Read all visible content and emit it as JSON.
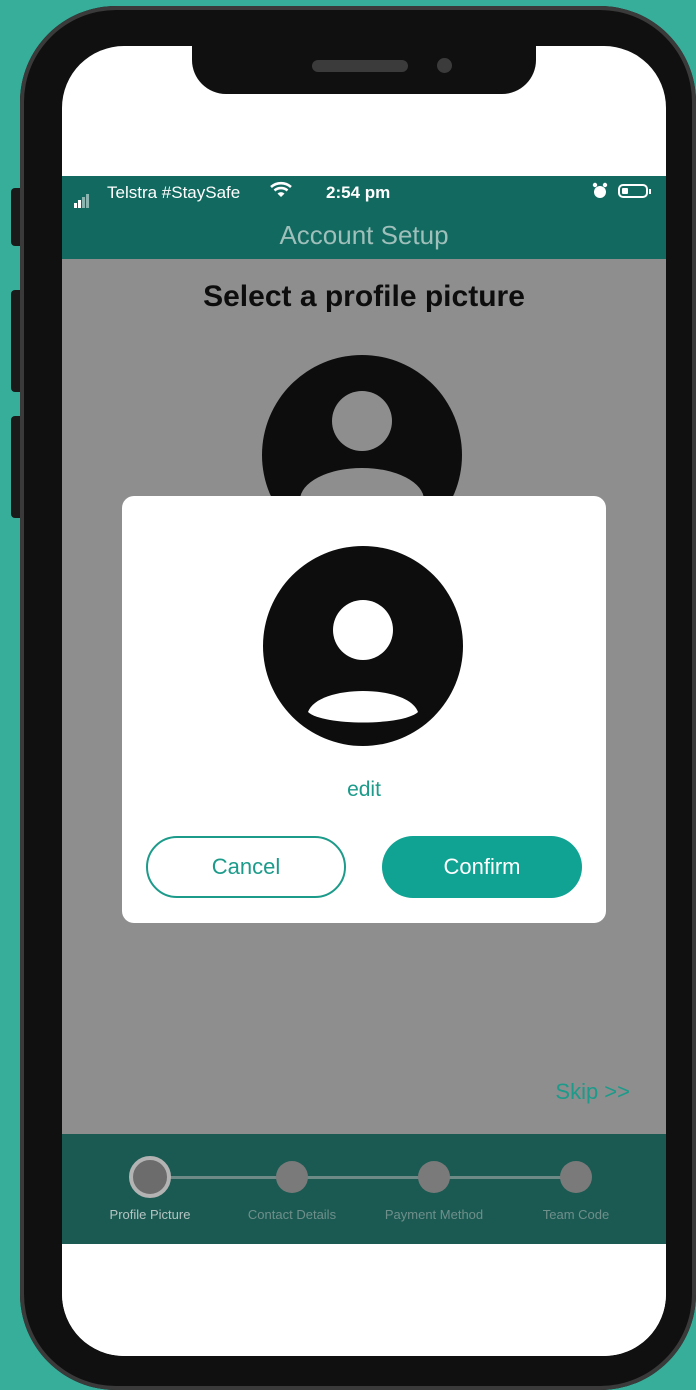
{
  "status_bar": {
    "carrier": "Telstra #StaySafe",
    "time": "2:54 pm"
  },
  "header": {
    "title": "Account Setup"
  },
  "page": {
    "title": "Select a profile picture",
    "skip_label": "Skip >>"
  },
  "modal": {
    "edit_label": "edit",
    "cancel_label": "Cancel",
    "confirm_label": "Confirm"
  },
  "stepper": {
    "steps": [
      {
        "label": "Profile Picture",
        "active": true
      },
      {
        "label": "Contact Details",
        "active": false
      },
      {
        "label": "Payment Method",
        "active": false
      },
      {
        "label": "Team Code",
        "active": false
      }
    ]
  },
  "colors": {
    "background": "#37ae9a",
    "header": "#12695f",
    "accent": "#1c9b8a",
    "confirm": "#10a394",
    "overlay": "#8e8e8e"
  },
  "icons": [
    "signal-icon",
    "wifi-icon",
    "alarm-icon",
    "battery-icon",
    "avatar-icon"
  ]
}
